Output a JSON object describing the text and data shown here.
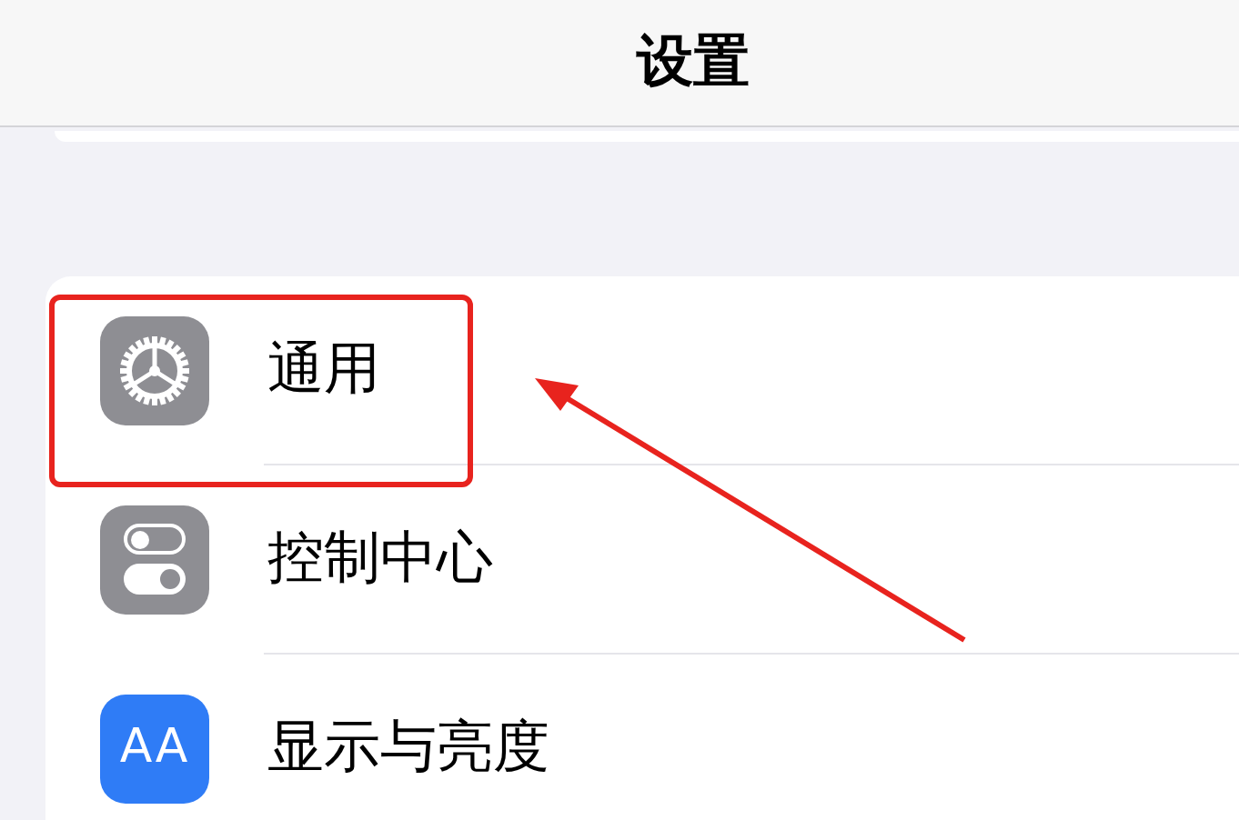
{
  "nav_bar": {
    "title": "设置"
  },
  "settings_rows": [
    {
      "label": "通用",
      "kind": "gear",
      "highlighted": true
    },
    {
      "label": "控制中心",
      "kind": "toggles",
      "highlighted": false
    },
    {
      "label": "显示与亮度",
      "kind": "text",
      "icon_text": "AA",
      "highlighted": false
    }
  ]
}
